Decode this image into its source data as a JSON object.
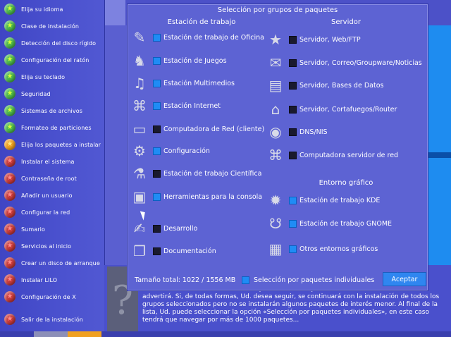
{
  "sidebar": {
    "steps": [
      {
        "label": "Elija su idioma",
        "state": "done",
        "icon": "green-star-icon"
      },
      {
        "label": "Clase de instalación",
        "state": "done",
        "icon": "green-star-icon"
      },
      {
        "label": "Detección del disco rígido",
        "state": "done",
        "icon": "green-star-icon"
      },
      {
        "label": "Configuración del ratón",
        "state": "done",
        "icon": "green-star-icon"
      },
      {
        "label": "Elija su teclado",
        "state": "done",
        "icon": "green-star-icon"
      },
      {
        "label": "Seguridad",
        "state": "done",
        "icon": "green-star-icon"
      },
      {
        "label": "Sistemas de archivos",
        "state": "done",
        "icon": "green-star-icon"
      },
      {
        "label": "Formateo de particiones",
        "state": "done",
        "icon": "green-star-icon"
      },
      {
        "label": "Elija los paquetes a instalar",
        "state": "current",
        "icon": "orange-star-icon"
      },
      {
        "label": "Instalar el sistema",
        "state": "todo",
        "icon": "red-star-icon"
      },
      {
        "label": "Contraseña de root",
        "state": "todo",
        "icon": "red-star-icon"
      },
      {
        "label": "Añadir un usuario",
        "state": "todo",
        "icon": "red-star-icon"
      },
      {
        "label": "Configurar la red",
        "state": "todo",
        "icon": "red-star-icon"
      },
      {
        "label": "Sumario",
        "state": "todo",
        "icon": "red-star-icon"
      },
      {
        "label": "Servicios al inicio",
        "state": "todo",
        "icon": "red-star-icon"
      },
      {
        "label": "Crear un disco de arranque",
        "state": "todo",
        "icon": "red-star-icon"
      },
      {
        "label": "Instalar LILO",
        "state": "todo",
        "icon": "red-star-icon"
      },
      {
        "label": "Configuración de X",
        "state": "todo",
        "icon": "red-star-icon"
      },
      {
        "label": "Salir de la instalación",
        "state": "todo",
        "icon": "red-star-icon"
      }
    ]
  },
  "dialog": {
    "title": "Selección por grupos de paquetes",
    "workstation_header": "Estación de trabajo",
    "server_header": "Servidor",
    "graphical_header": "Entorno gráfico",
    "workstation": [
      {
        "label": "Estación de trabajo de Oficina",
        "checked": true,
        "icon": "office-icon"
      },
      {
        "label": "Estación de Juegos",
        "checked": true,
        "icon": "games-icon"
      },
      {
        "label": "Estación Multimedios",
        "checked": true,
        "icon": "multimedia-icon"
      },
      {
        "label": "Estación Internet",
        "checked": true,
        "icon": "internet-icon"
      },
      {
        "label": "Computadora de Red (cliente)",
        "checked": false,
        "icon": "network-computer-icon"
      },
      {
        "label": "Configuración",
        "checked": true,
        "icon": "configuration-icon"
      },
      {
        "label": "Estación de trabajo Científica",
        "checked": false,
        "icon": "science-icon"
      },
      {
        "label": "Herramientas para la consola",
        "checked": true,
        "icon": "console-icon"
      },
      {
        "label": "Desarrollo",
        "checked": false,
        "icon": "development-icon"
      },
      {
        "label": "Documentación",
        "checked": false,
        "icon": "documentation-icon"
      }
    ],
    "server": [
      {
        "label": "Servidor, Web/FTP",
        "checked": false,
        "icon": "web-server-icon"
      },
      {
        "label": "Servidor, Correo/Groupware/Noticias",
        "checked": false,
        "icon": "mail-server-icon"
      },
      {
        "label": "Servidor, Bases de Datos",
        "checked": false,
        "icon": "database-server-icon"
      },
      {
        "label": "Servidor, Cortafuegos/Router",
        "checked": false,
        "icon": "firewall-icon"
      },
      {
        "label": "DNS/NIS",
        "checked": false,
        "icon": "dns-icon"
      },
      {
        "label": "Computadora servidor de red",
        "checked": false,
        "icon": "network-server-icon"
      }
    ],
    "graphical": [
      {
        "label": "Estación de trabajo KDE",
        "checked": true,
        "icon": "kde-icon"
      },
      {
        "label": "Estación de trabajo GNOME",
        "checked": true,
        "icon": "gnome-icon"
      },
      {
        "label": "Otros entornos gráficos",
        "checked": true,
        "icon": "other-desktops-icon"
      }
    ],
    "total_size": "Tamaño total: 1022 / 1556 MB",
    "individual_label": "Selección por paquetes individuales",
    "individual_checked": true,
    "accept_label": "Aceptar"
  },
  "help": {
    "text": "Entonces DrakX verificará si tiene espacio suficiente para instalarlos a todos. Si no, le advertirá. Si, de todas formas, Ud. desea seguir, se continuará con la instalación de todos los grupos seleccionados pero no se instalarán algunos paquetes de interés menor. Al final de la lista, Ud. puede seleccionar la opción «Selección por paquetes individuales», en este caso tendrá que navegar por más de 1000 paquetes..."
  },
  "colors": {
    "checkbox_on": "#1f8cf5",
    "checkbox_off": "#1a1a2e",
    "dialog_bg": "#5d63d3",
    "sidebar_bg": "#4b52cf",
    "step_done": "#4cb84c",
    "step_current": "#f0a020",
    "step_todo": "#c83a3a"
  }
}
